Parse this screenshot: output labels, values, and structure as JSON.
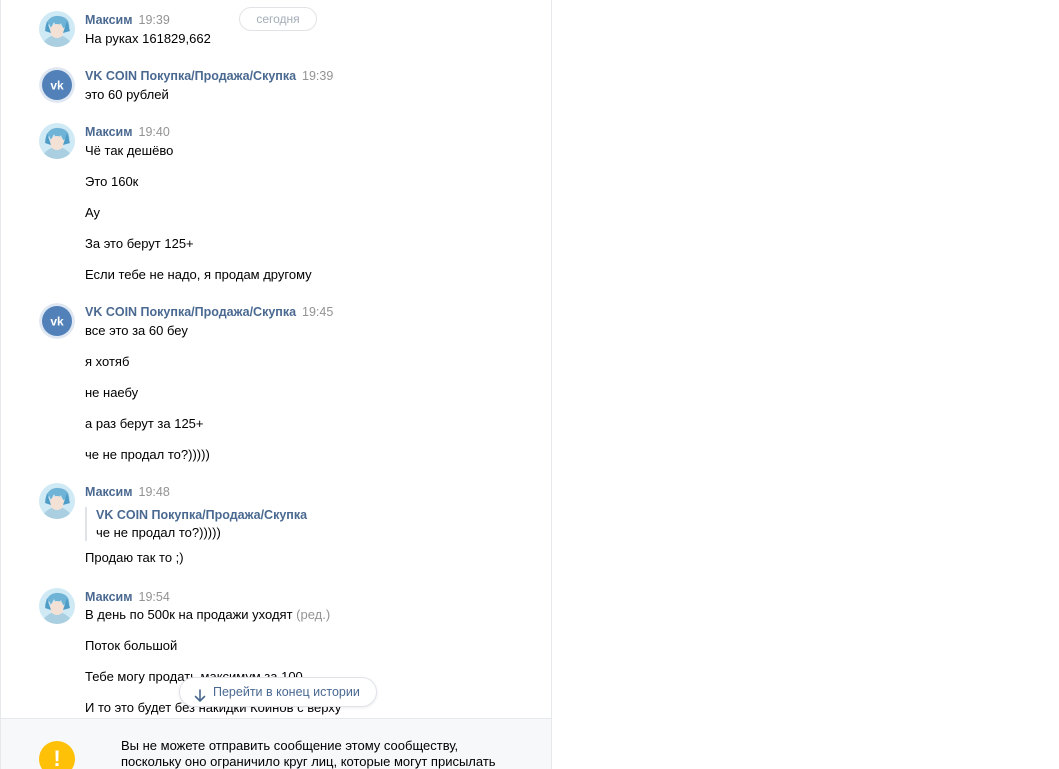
{
  "date_separator": "сегодня",
  "colors": {
    "author_link": "#4a6991",
    "timestamp": "#939393",
    "community_avatar": "#5181b8",
    "warning": "#ffc107"
  },
  "messages": [
    {
      "author": "Максим",
      "time": "19:39",
      "avatar": "user-avatar",
      "lines": [
        "На руках 161829,662"
      ]
    },
    {
      "author": "VK COIN Покупка/Продажа/Скупка",
      "time": "19:39",
      "avatar": "vk-logo-icon",
      "lines": [
        "это 60 рублей"
      ]
    },
    {
      "author": "Максим",
      "time": "19:40",
      "avatar": "user-avatar",
      "lines": [
        "Чё так дешёво",
        "Это 160к",
        "Ау",
        "За это берут 125+",
        "Если тебе не надо, я продам другому"
      ]
    },
    {
      "author": "VK COIN Покупка/Продажа/Скупка",
      "time": "19:45",
      "avatar": "vk-logo-icon",
      "lines": [
        "все это за 60 беу",
        "я хотяб",
        "не наебу",
        "а раз берут за 125+",
        "че не продал то?)))))"
      ]
    },
    {
      "author": "Максим",
      "time": "19:48",
      "avatar": "user-avatar",
      "quote": {
        "author": "VK COIN Покупка/Продажа/Скупка",
        "text": "че не продал то?)))))"
      },
      "lines": [
        "Продаю так то ;)"
      ]
    },
    {
      "author": "Максим",
      "time": "19:54",
      "avatar": "user-avatar",
      "lines": [
        "В день по 500к на продажи уходят",
        "Поток большой",
        "Тебе могу продать максимум за 100",
        "И то это будет без накидки Коинов с верху"
      ],
      "edited": "(ред.)"
    }
  ],
  "jump_button": {
    "label": "Перейти в конец истории",
    "icon": "arrow-down-icon"
  },
  "footer": {
    "icon": "warning-icon",
    "icon_glyph": "!",
    "notice": "Вы не можете отправить сообщение этому сообществу, поскольку оно ограничило круг лиц, которые могут присылать"
  }
}
